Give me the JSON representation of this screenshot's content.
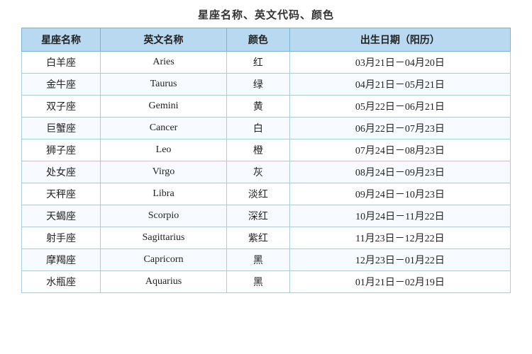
{
  "title": "星座名称、英文代码、颜色",
  "headers": {
    "col1": "星座名称",
    "col2": "英文名称",
    "col3": "颜色",
    "col4": "出生日期（阳历）"
  },
  "rows": [
    {
      "chinese": "白羊座",
      "english": "Aries",
      "color": "红",
      "date": "03月21日－04月20日"
    },
    {
      "chinese": "金牛座",
      "english": "Taurus",
      "color": "绿",
      "date": "04月21日－05月21日"
    },
    {
      "chinese": "双子座",
      "english": "Gemini",
      "color": "黄",
      "date": "05月22日－06月21日"
    },
    {
      "chinese": "巨蟹座",
      "english": "Cancer",
      "color": "白",
      "date": "06月22日－07月23日"
    },
    {
      "chinese": "狮子座",
      "english": "Leo",
      "color": "橙",
      "date": "07月24日－08月23日"
    },
    {
      "chinese": "处女座",
      "english": "Virgo",
      "color": "灰",
      "date": "08月24日－09月23日"
    },
    {
      "chinese": "天秤座",
      "english": "Libra",
      "color": "淡红",
      "date": "09月24日－10月23日"
    },
    {
      "chinese": "天蝎座",
      "english": "Scorpio",
      "color": "深红",
      "date": "10月24日－11月22日"
    },
    {
      "chinese": "射手座",
      "english": "Sagittarius",
      "color": "紫红",
      "date": "11月23日－12月22日"
    },
    {
      "chinese": "摩羯座",
      "english": "Capricorn",
      "color": "黑",
      "date": "12月23日－01月22日"
    },
    {
      "chinese": "水瓶座",
      "english": "Aquarius",
      "color": "黑",
      "date": "01月21日－02月19日"
    }
  ]
}
